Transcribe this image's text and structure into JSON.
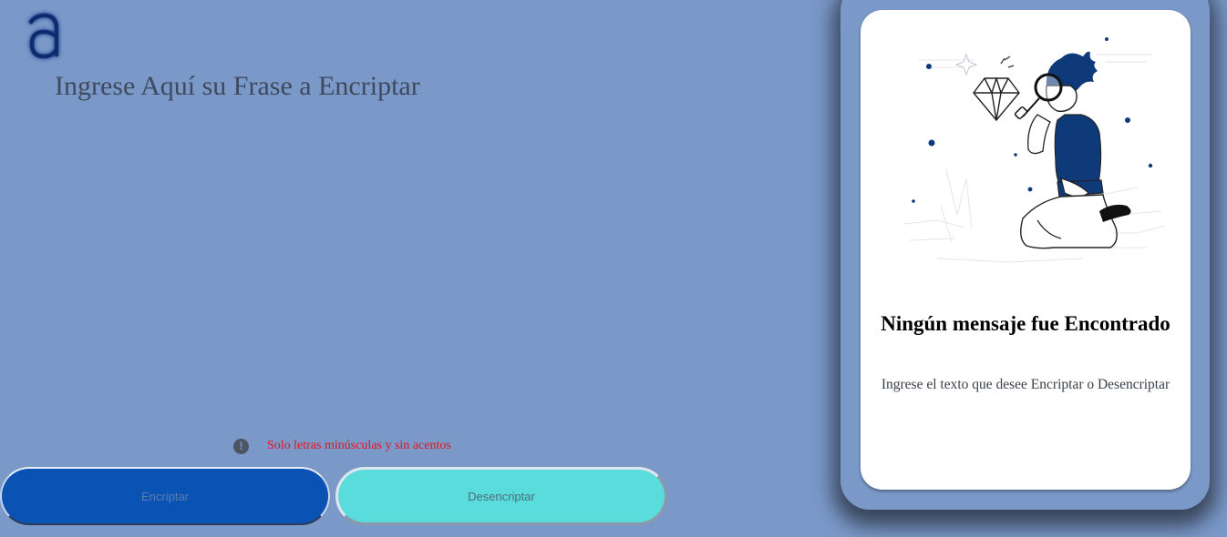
{
  "app": {
    "logo_icon": "letter-a-logo-icon"
  },
  "colors": {
    "background": "#7a98c8",
    "encrypt_button": "#0a52b4",
    "decrypt_button": "#5adcdc",
    "warning_text": "#e8141c",
    "card": "#ffffff"
  },
  "input": {
    "placeholder": "Ingrese Aquí su Frase a Encriptar",
    "value": ""
  },
  "hint": {
    "icon": "exclamation-circle-icon",
    "text": "Solo letras minúsculas y sin acentos"
  },
  "buttons": {
    "encrypt_label": "Encriptar",
    "decrypt_label": "Desencriptar"
  },
  "result_panel": {
    "illustration": "person-with-magnifying-glass-examining-diamond",
    "title": "Ningún mensaje fue Encontrado",
    "message": "Ingrese el texto que desee Encriptar o Desencriptar"
  }
}
